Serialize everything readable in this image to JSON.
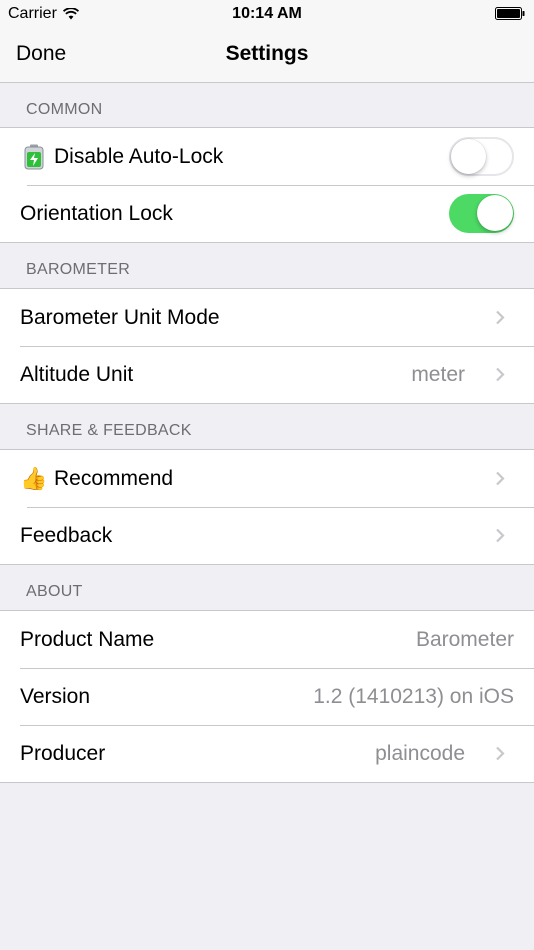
{
  "status_bar": {
    "carrier": "Carrier",
    "time": "10:14 AM",
    "wifi_icon": "wifi-icon",
    "battery_icon": "battery-icon"
  },
  "nav": {
    "done_label": "Done",
    "title": "Settings"
  },
  "sections": {
    "common": {
      "header": "COMMON",
      "auto_lock": {
        "icon": "battery-charging-emoji-icon",
        "label": "Disable Auto-Lock",
        "toggle": false
      },
      "orientation_lock": {
        "label": "Orientation Lock",
        "toggle": true
      }
    },
    "barometer": {
      "header": "BAROMETER",
      "unit_mode": {
        "label": "Barometer Unit Mode"
      },
      "altitude_unit": {
        "label": "Altitude Unit",
        "value": "meter"
      }
    },
    "share": {
      "header": "SHARE & FEEDBACK",
      "recommend": {
        "icon": "thumbs-up-emoji-icon",
        "emoji": "👍",
        "label": "Recommend"
      },
      "feedback": {
        "label": "Feedback"
      }
    },
    "about": {
      "header": "ABOUT",
      "product_name": {
        "label": "Product Name",
        "value": "Barometer"
      },
      "version": {
        "label": "Version",
        "value": "1.2 (1410213) on iOS"
      },
      "producer": {
        "label": "Producer",
        "value": "plaincode"
      }
    }
  },
  "colors": {
    "toggle_on": "#4cd964",
    "background": "#efeff4",
    "secondary_text": "#8e8e93",
    "section_header": "#6d6d72"
  }
}
